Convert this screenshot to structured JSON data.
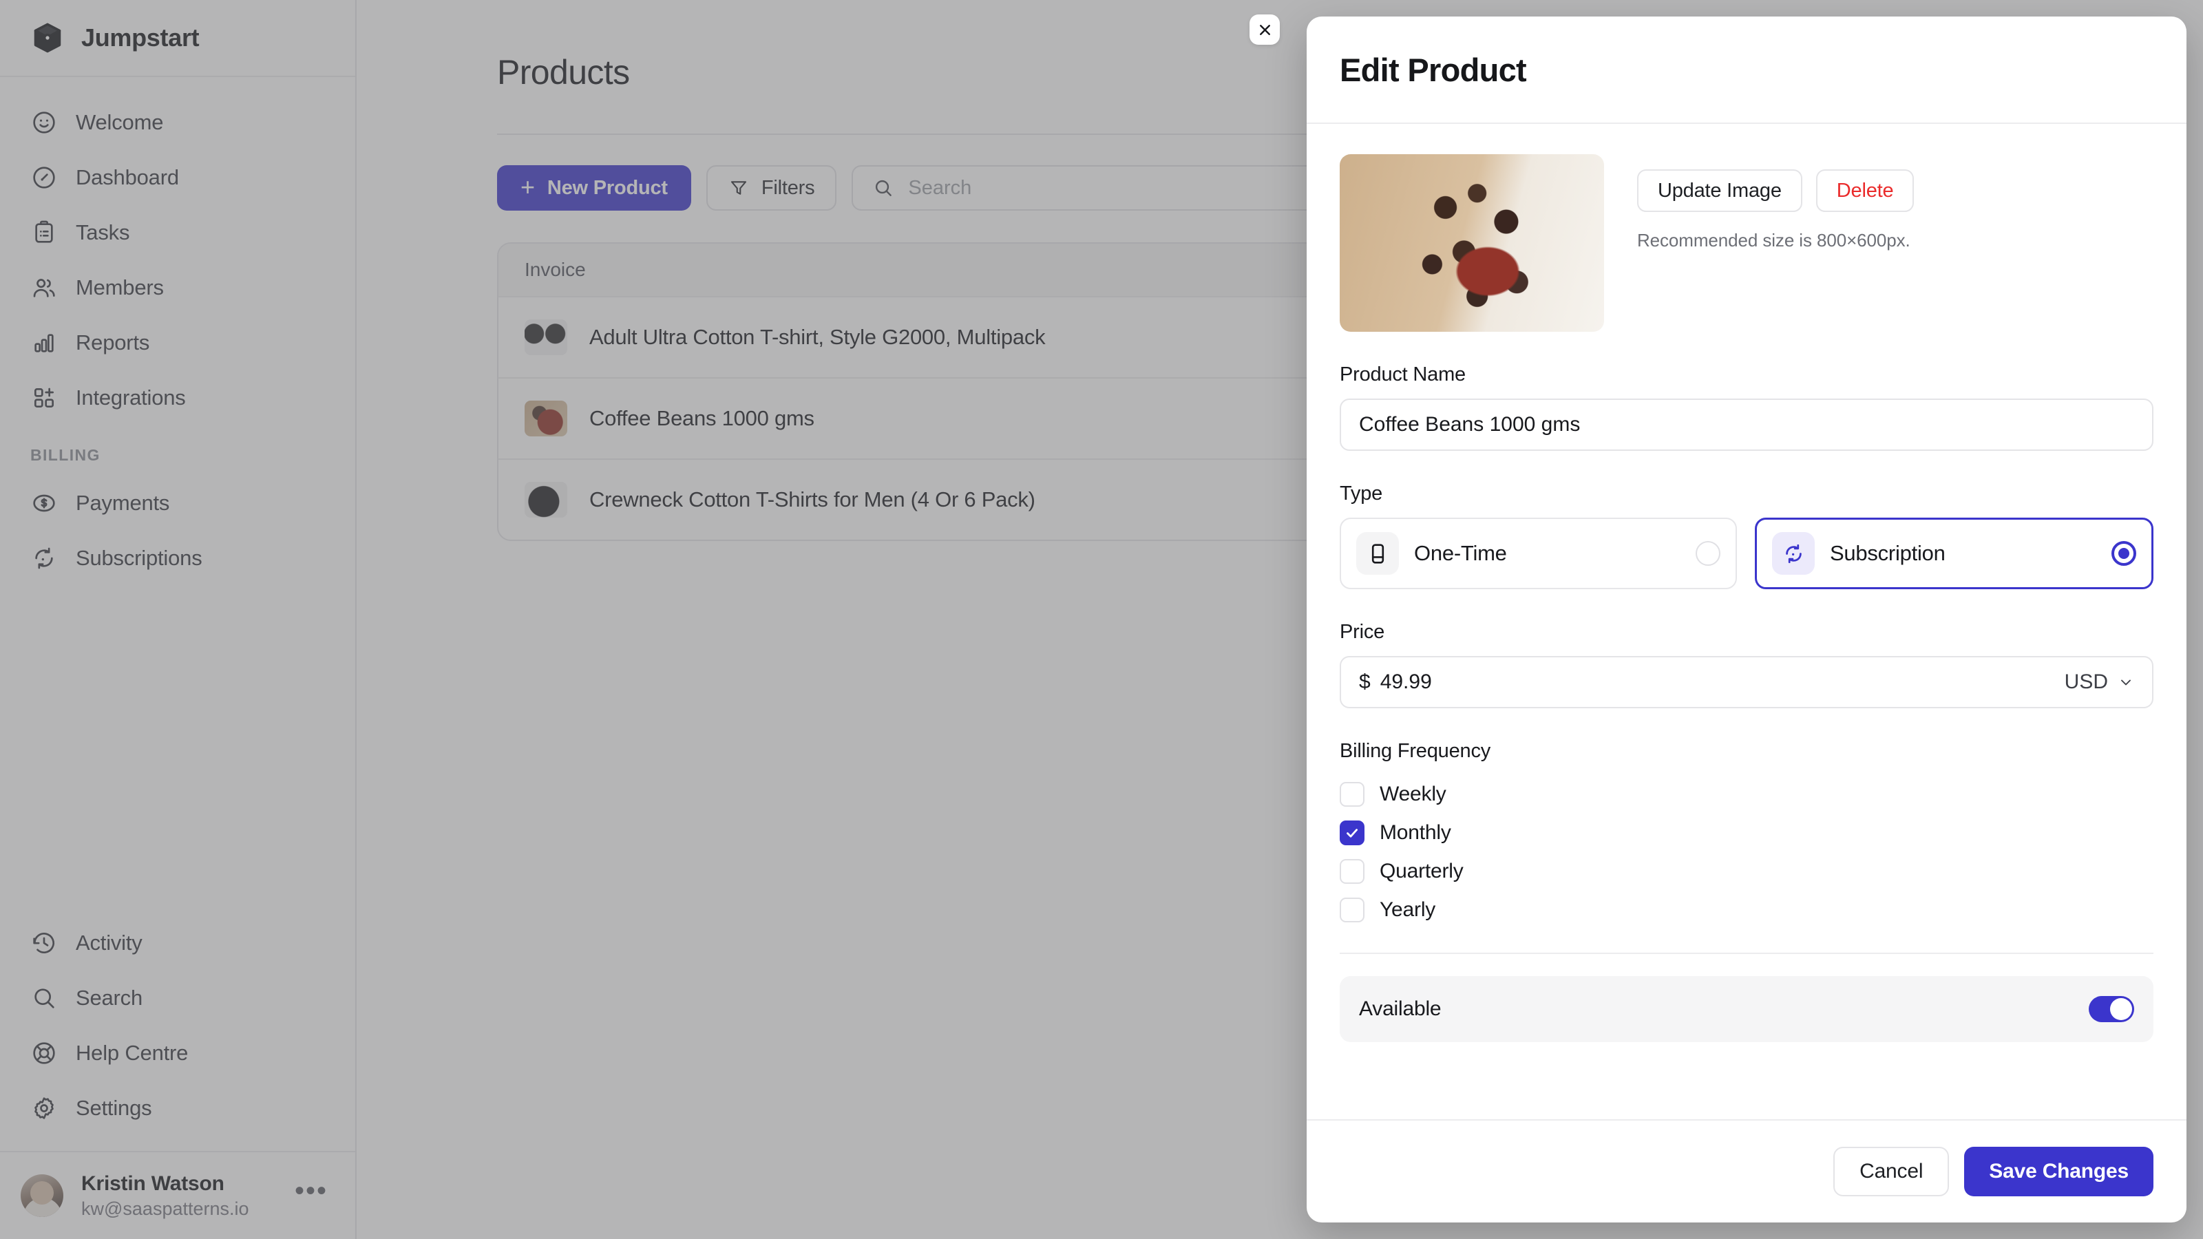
{
  "sidebar": {
    "brand": "Jumpstart",
    "items": [
      {
        "label": "Welcome",
        "icon": "smiley-icon"
      },
      {
        "label": "Dashboard",
        "icon": "gauge-icon"
      },
      {
        "label": "Tasks",
        "icon": "clipboard-icon"
      },
      {
        "label": "Members",
        "icon": "users-icon"
      },
      {
        "label": "Reports",
        "icon": "bar-chart-icon"
      },
      {
        "label": "Integrations",
        "icon": "squares-plus-icon"
      }
    ],
    "section_title": "BILLING",
    "billing_items": [
      {
        "label": "Payments",
        "icon": "dollar-circle-icon"
      },
      {
        "label": "Subscriptions",
        "icon": "refresh-icon"
      }
    ],
    "bottom_items": [
      {
        "label": "Activity",
        "icon": "clock-history-icon"
      },
      {
        "label": "Search",
        "icon": "search-icon"
      },
      {
        "label": "Help Centre",
        "icon": "lifebuoy-icon"
      },
      {
        "label": "Settings",
        "icon": "gear-icon"
      }
    ],
    "user": {
      "name": "Kristin Watson",
      "email": "kw@saaspatterns.io",
      "more": "•••"
    }
  },
  "main": {
    "page_title": "Products",
    "toolbar": {
      "new_product_label": "New Product",
      "new_product_plus": "+",
      "filters_label": "Filters",
      "search_placeholder": "Search",
      "search_value": ""
    },
    "table": {
      "header": "Invoice",
      "rows": [
        {
          "title": "Adult Ultra Cotton T-shirt, Style G2000, Multipack",
          "thumb": "tshirt"
        },
        {
          "title": "Coffee Beans 1000 gms",
          "thumb": "coffee"
        },
        {
          "title": "Crewneck Cotton T-Shirts for Men (4 Or 6 Pack)",
          "thumb": "crew"
        }
      ]
    }
  },
  "modal": {
    "title": "Edit Product",
    "close_icon": "close-icon",
    "image": {
      "alt": "coffee-beans-photo",
      "update_label": "Update Image",
      "delete_label": "Delete",
      "hint": "Recommended size is 800×600px."
    },
    "product_name": {
      "label": "Product Name",
      "value": "Coffee Beans 1000 gms",
      "placeholder": "Product name"
    },
    "type": {
      "label": "Type",
      "options": [
        {
          "label": "One-Time",
          "icon": "card-icon",
          "selected": false
        },
        {
          "label": "Subscription",
          "icon": "refresh-icon",
          "selected": true
        }
      ]
    },
    "price": {
      "label": "Price",
      "symbol": "$",
      "value": "49.99",
      "currency": "USD"
    },
    "billing_frequency": {
      "label": "Billing Frequency",
      "options": [
        {
          "label": "Weekly",
          "checked": false
        },
        {
          "label": "Monthly",
          "checked": true
        },
        {
          "label": "Quarterly",
          "checked": false
        },
        {
          "label": "Yearly",
          "checked": false
        }
      ]
    },
    "available": {
      "label": "Available",
      "on": true
    },
    "footer": {
      "cancel_label": "Cancel",
      "save_label": "Save Changes"
    }
  },
  "colors": {
    "primary": "#3b35cc",
    "danger": "#ea2b2b",
    "text": "#18191d",
    "muted": "#6d6f76",
    "border": "#e4e4e7",
    "surface": "#f5f5f6"
  }
}
